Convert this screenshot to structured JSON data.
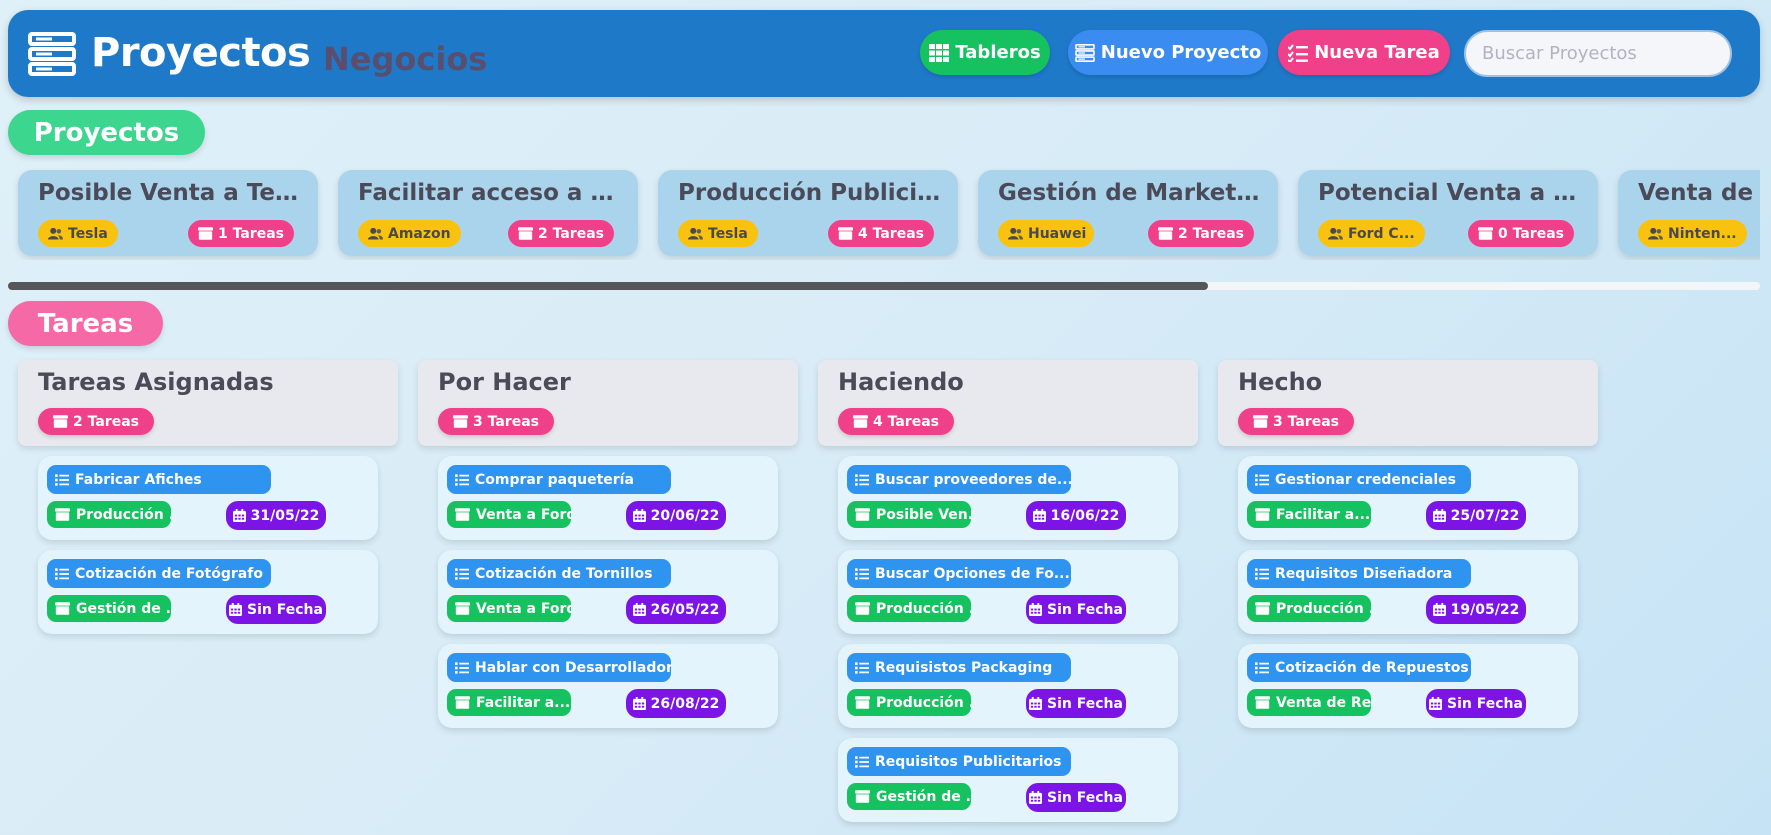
{
  "header": {
    "title": "Proyectos",
    "board": "Negocios",
    "buttons": {
      "tableros": "Tableros",
      "nuevo_proyecto": "Nuevo Proyecto",
      "nueva_tarea": "Nueva Tarea"
    },
    "search_placeholder": "Buscar Proyectos",
    "search_value": ""
  },
  "sections": {
    "projects": "Proyectos",
    "tasks": "Tareas"
  },
  "projects": [
    {
      "title": "Posible Venta a Tesla",
      "client": "Tesla",
      "tasks": "1 Tareas"
    },
    {
      "title": "Facilitar acceso a Amazon",
      "client": "Amazon",
      "tasks": "2 Tareas"
    },
    {
      "title": "Producción Publicitaria",
      "client": "Tesla",
      "tasks": "4 Tareas"
    },
    {
      "title": "Gestión de Marketing",
      "client": "Huawei",
      "tasks": "2 Tareas"
    },
    {
      "title": "Potencial Venta a Ford",
      "client": "Ford C...",
      "tasks": "0 Tareas"
    },
    {
      "title": "Venta de Repuestos",
      "client": "Ninten...",
      "tasks": ""
    }
  ],
  "columns": [
    {
      "title": "Tareas Asignadas",
      "count": "2 Tareas",
      "tasks": [
        {
          "name": "Fabricar Afiches",
          "project": "Producción ...",
          "date": "31/05/22"
        },
        {
          "name": "Cotización de Fotógrafo",
          "project": "Gestión de ...",
          "date": "Sin Fecha"
        }
      ]
    },
    {
      "title": "Por Hacer",
      "count": "3 Tareas",
      "tasks": [
        {
          "name": "Comprar paquetería",
          "project": "Venta a Ford",
          "date": "20/06/22"
        },
        {
          "name": "Cotización de Tornillos",
          "project": "Venta a Ford",
          "date": "26/05/22"
        },
        {
          "name": "Hablar con Desarrollador",
          "project": "Facilitar a...",
          "date": "26/08/22"
        }
      ]
    },
    {
      "title": "Haciendo",
      "count": "4 Tareas",
      "tasks": [
        {
          "name": "Buscar proveedores de...",
          "project": "Posible Ven...",
          "date": "16/06/22"
        },
        {
          "name": "Buscar Opciones de Fo...",
          "project": "Producción ...",
          "date": "Sin Fecha"
        },
        {
          "name": "Requisistos Packaging",
          "project": "Producción ...",
          "date": "Sin Fecha"
        },
        {
          "name": "Requisitos Publicitarios",
          "project": "Gestión de ...",
          "date": "Sin Fecha"
        }
      ]
    },
    {
      "title": "Hecho",
      "count": "3 Tareas",
      "tasks": [
        {
          "name": "Gestionar credenciales",
          "project": "Facilitar a...",
          "date": "25/07/22"
        },
        {
          "name": "Requisitos Diseñadora",
          "project": "Producción ...",
          "date": "19/05/22"
        },
        {
          "name": "Cotización de Repuestos",
          "project": "Venta de Re...",
          "date": "Sin Fecha"
        }
      ]
    }
  ],
  "colors": {
    "header": "#1f79c9",
    "green": "#16c25f",
    "blue": "#3b8cf0",
    "pink": "#f1408a",
    "yellow": "#f8c20f",
    "purple": "#7c14e6",
    "project_card": "#aad4ec",
    "task_card": "#e3f4fc"
  },
  "icons": {
    "brand": "server-stack-icon",
    "tableros": "grid-icon",
    "nuevo_proyecto": "server-stack-icon",
    "nueva_tarea": "checklist-icon",
    "client": "user-group-icon",
    "count": "folder-icon",
    "task": "list-icon",
    "date": "calendar-icon"
  }
}
